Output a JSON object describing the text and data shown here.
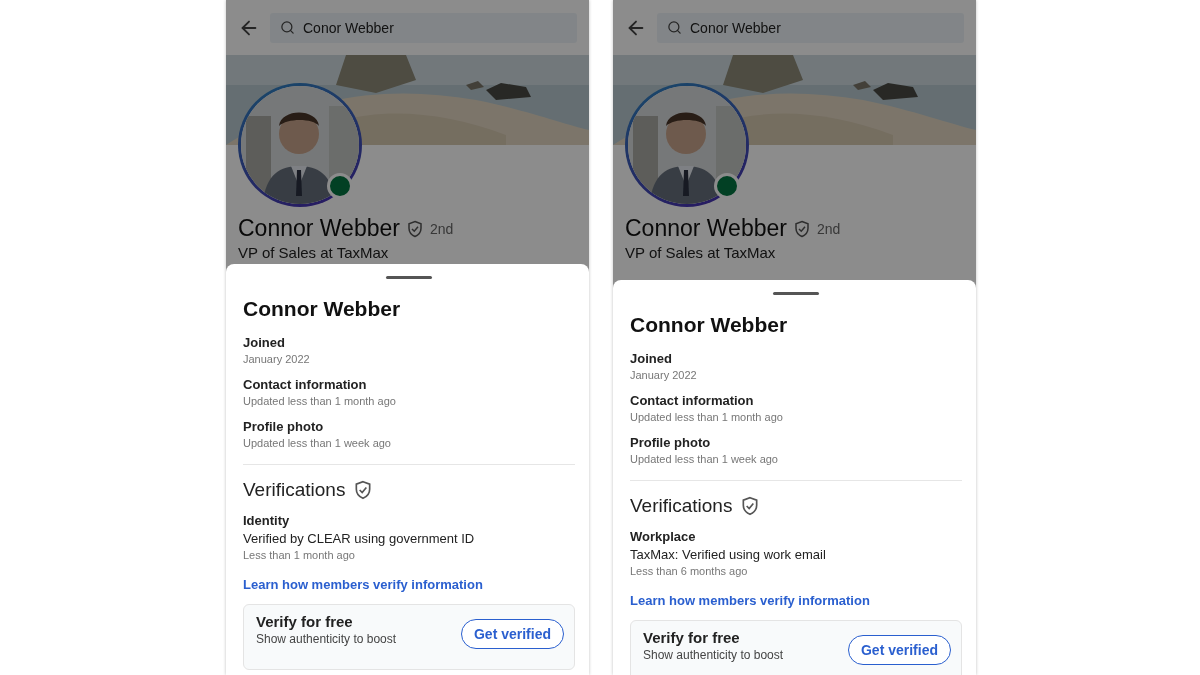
{
  "phones": [
    {
      "search": {
        "value": "Conor Webber"
      },
      "profile": {
        "name": "Connor Webber",
        "degree": "2nd",
        "headline": "VP of Sales at TaxMax",
        "online": true
      },
      "sheet": {
        "title": "Connor Webber",
        "details": [
          {
            "label": "Joined",
            "value": "January 2022"
          },
          {
            "label": "Contact information",
            "value": "Updated less than 1 month ago"
          },
          {
            "label": "Profile photo",
            "value": "Updated less than 1 week ago"
          }
        ],
        "verifications_title": "Verifications",
        "verifications": [
          {
            "type": "Identity",
            "detail": "Verified by CLEAR using government ID",
            "time": "Less than 1 month ago"
          }
        ],
        "link": "Learn how members verify information",
        "promo": {
          "title": "Verify for free",
          "text": "Show authenticity to boost",
          "button": "Get verified"
        }
      }
    },
    {
      "search": {
        "value": "Conor Webber"
      },
      "profile": {
        "name": "Connor Webber",
        "degree": "2nd",
        "headline": "VP of Sales at TaxMax",
        "online": true
      },
      "sheet": {
        "title": "Connor Webber",
        "details": [
          {
            "label": "Joined",
            "value": "January 2022"
          },
          {
            "label": "Contact information",
            "value": "Updated less than 1 month ago"
          },
          {
            "label": "Profile photo",
            "value": "Updated less than 1 week ago"
          }
        ],
        "verifications_title": "Verifications",
        "verifications": [
          {
            "type": "Workplace",
            "detail": "TaxMax: Verified using work email",
            "time": "Less than 6 months ago"
          }
        ],
        "link": "Learn how members verify information",
        "promo": {
          "title": "Verify for free",
          "text": "Show authenticity to boost",
          "button": "Get verified"
        }
      }
    }
  ]
}
